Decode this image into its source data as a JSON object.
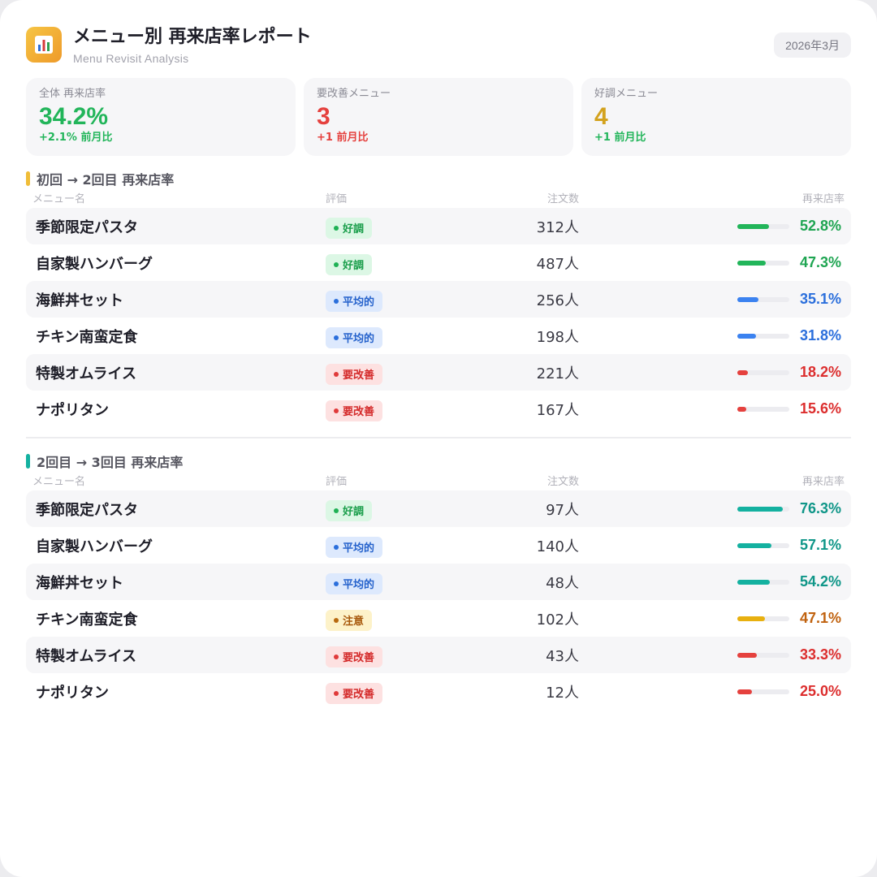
{
  "header": {
    "title": "メニュー別 再来店率レポート",
    "subtitle": "Menu Revisit Analysis",
    "date": "2026年3月",
    "icon": "bar-chart-icon"
  },
  "colors": {
    "green": "#22b55a",
    "red": "#e5413e",
    "gold": "#d3a21e",
    "blue": "#2b6fdc",
    "teal": "#14b1a0"
  },
  "kpis": [
    {
      "label": "全体 再来店率",
      "value": "34.2%",
      "change": "+2.1% 前月比",
      "color": "#22b55a"
    },
    {
      "label": "要改善メニュー",
      "value": "3",
      "change": "+1 前月比",
      "color": "#e5413e",
      "change_color": "#e5413e"
    },
    {
      "label": "好調メニュー",
      "value": "4",
      "change": "+1 前月比",
      "color": "#d3a21e"
    }
  ],
  "columns": {
    "name": "メニュー名",
    "eval": "評価",
    "count": "注文数",
    "rate": "再来店率"
  },
  "sections": [
    {
      "title": "初回 → 2回目 再来店率",
      "accent": "#f0bd38",
      "rows": [
        {
          "name": "季節限定パスタ",
          "status": "好調",
          "status_type": "good",
          "count": "312人",
          "rate": "52.8%",
          "rate_value": 52.8,
          "bar_color": "#22b55a",
          "text_color": "#1fa552"
        },
        {
          "name": "自家製ハンバーグ",
          "status": "好調",
          "status_type": "good",
          "count": "487人",
          "rate": "47.3%",
          "rate_value": 47.3,
          "bar_color": "#22b55a",
          "text_color": "#1fa552"
        },
        {
          "name": "海鮮丼セット",
          "status": "平均的",
          "status_type": "avg",
          "count": "256人",
          "rate": "35.1%",
          "rate_value": 35.1,
          "bar_color": "#3b82f0",
          "text_color": "#2b6fdc"
        },
        {
          "name": "チキン南蛮定食",
          "status": "平均的",
          "status_type": "avg",
          "count": "198人",
          "rate": "31.8%",
          "rate_value": 31.8,
          "bar_color": "#3b82f0",
          "text_color": "#2b6fdc"
        },
        {
          "name": "特製オムライス",
          "status": "要改善",
          "status_type": "bad",
          "count": "221人",
          "rate": "18.2%",
          "rate_value": 18.2,
          "bar_color": "#e5413e",
          "text_color": "#dc2e2e"
        },
        {
          "name": "ナポリタン",
          "status": "要改善",
          "status_type": "bad",
          "count": "167人",
          "rate": "15.6%",
          "rate_value": 15.6,
          "bar_color": "#e5413e",
          "text_color": "#dc2e2e"
        }
      ]
    },
    {
      "title": "2回目 → 3回目 再来店率",
      "accent": "#14b1a0",
      "rows": [
        {
          "name": "季節限定パスタ",
          "status": "好調",
          "status_type": "good",
          "count": "97人",
          "rate": "76.3%",
          "rate_value": 76.3,
          "bar_color": "#14b1a0",
          "text_color": "#0f9688"
        },
        {
          "name": "自家製ハンバーグ",
          "status": "平均的",
          "status_type": "avg",
          "count": "140人",
          "rate": "57.1%",
          "rate_value": 57.1,
          "bar_color": "#14b1a0",
          "text_color": "#0f9688"
        },
        {
          "name": "海鮮丼セット",
          "status": "平均的",
          "status_type": "avg",
          "count": "48人",
          "rate": "54.2%",
          "rate_value": 54.2,
          "bar_color": "#14b1a0",
          "text_color": "#0f9688"
        },
        {
          "name": "チキン南蛮定食",
          "status": "注意",
          "status_type": "warn",
          "count": "102人",
          "rate": "47.1%",
          "rate_value": 47.1,
          "bar_color": "#e8b00f",
          "text_color": "#c0620f"
        },
        {
          "name": "特製オムライス",
          "status": "要改善",
          "status_type": "bad",
          "count": "43人",
          "rate": "33.3%",
          "rate_value": 33.3,
          "bar_color": "#e5413e",
          "text_color": "#dc2e2e"
        },
        {
          "name": "ナポリタン",
          "status": "要改善",
          "status_type": "bad",
          "count": "12人",
          "rate": "25.0%",
          "rate_value": 25.0,
          "bar_color": "#e5413e",
          "text_color": "#dc2e2e"
        }
      ]
    }
  ]
}
